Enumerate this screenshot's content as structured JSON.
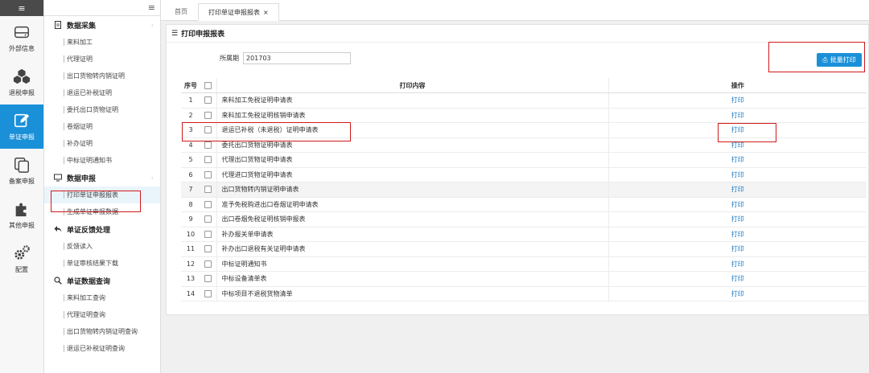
{
  "iconbar": {
    "toggle": "≡",
    "items": [
      {
        "label": "外部信息",
        "icon": "drive-icon"
      },
      {
        "label": "退税申报",
        "icon": "cubes-icon"
      },
      {
        "label": "单证申报",
        "icon": "edit-icon"
      },
      {
        "label": "备案申报",
        "icon": "copy-icon"
      },
      {
        "label": "其他申报",
        "icon": "puzzle-icon"
      },
      {
        "label": "配置",
        "icon": "gears-icon"
      }
    ],
    "active_color": "#1a90d8"
  },
  "menu": {
    "toggle": "≡",
    "groups": [
      {
        "title": "数据采集",
        "items": [
          "来料加工",
          "代理证明",
          "出口货物转内销证明",
          "退运已补税证明",
          "委托出口货物证明",
          "卷烟证明",
          "补办证明",
          "中标证明通知书"
        ]
      },
      {
        "title": "数据申报",
        "items": [
          "打印单证申报报表",
          "生成单证申报数据"
        ]
      },
      {
        "title": "单证反馈处理",
        "items": [
          "反馈读入",
          "单证审核结果下载"
        ]
      },
      {
        "title": "单证数据查询",
        "items": [
          "来料加工查询",
          "代理证明查询",
          "出口货物转内销证明查询",
          "退运已补税证明查询"
        ]
      }
    ]
  },
  "tabs": [
    {
      "label": "首页"
    },
    {
      "label": "打印单证申报报表",
      "close": "×"
    }
  ],
  "panel": {
    "title": "打印申报报表",
    "period_label": "所属期",
    "period_value": "201703",
    "batch_print": "批量打印",
    "headers": {
      "no": "序号",
      "content": "打印内容",
      "op": "操作"
    },
    "rows": [
      {
        "no": "1",
        "content": "来料加工免税证明申请表",
        "op": "打印"
      },
      {
        "no": "2",
        "content": "来料加工免税证明核销申请表",
        "op": "打印"
      },
      {
        "no": "3",
        "content": "退运已补税（未退税）证明申请表",
        "op": "打印"
      },
      {
        "no": "4",
        "content": "委托出口货物证明申请表",
        "op": "打印"
      },
      {
        "no": "5",
        "content": "代理出口货物证明申请表",
        "op": "打印"
      },
      {
        "no": "6",
        "content": "代理进口货物证明申请表",
        "op": "打印"
      },
      {
        "no": "7",
        "content": "出口货物转内销证明申请表",
        "op": "打印"
      },
      {
        "no": "8",
        "content": "准予免税购进出口卷烟证明申请表",
        "op": "打印"
      },
      {
        "no": "9",
        "content": "出口卷烟免税证明核销申报表",
        "op": "打印"
      },
      {
        "no": "10",
        "content": "补办报关单申请表",
        "op": "打印"
      },
      {
        "no": "11",
        "content": "补办出口退税有关证明申请表",
        "op": "打印"
      },
      {
        "no": "12",
        "content": "中标证明通知书",
        "op": "打印"
      },
      {
        "no": "13",
        "content": "中标设备清单表",
        "op": "打印"
      },
      {
        "no": "14",
        "content": "中标项目不退税货物清单",
        "op": "打印"
      }
    ]
  },
  "colors": {
    "accent": "#1a90d8",
    "link": "#1a7ac8",
    "highlight_box": "#d01a1a"
  }
}
